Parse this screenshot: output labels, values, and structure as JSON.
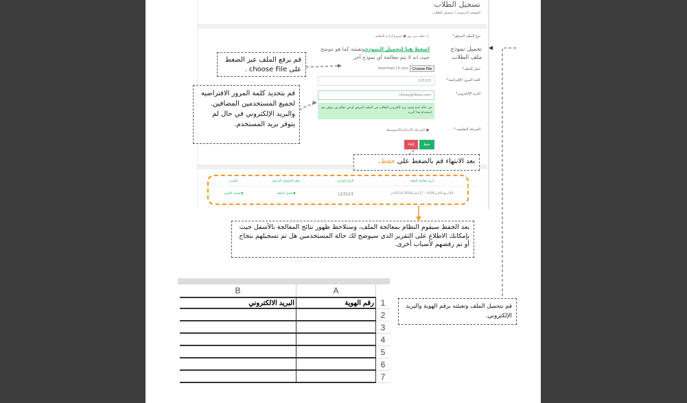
{
  "app": {
    "title": "تسجيل الطلاب",
    "breadcrumb_home": "الصفحة الرئيسية",
    "breadcrumb_sep": "/",
    "breadcrumb_current": "تسجيل الطلاب"
  },
  "form": {
    "file_type_label": "نوع الملف المرفق*",
    "radio_noor": "ملف من نور",
    "radio_template": "نموذج إدارة التعليم",
    "template_label": "تحميل نموذج ملف الطلاب",
    "template_link": "اضغط هنا لتحميل النموذج",
    "template_text": "وتعبئته كما هو موضح حيث انه لا يتم معالجة أي نموذج آخر",
    "upload_label": "حمل الملف*",
    "choose_file": "Choose File",
    "file_name": "download (3).xlsx",
    "password_label": "كلمة المرور الإفتراضية*",
    "password_value": "123123",
    "email_label": "البريد الإلكتروني*",
    "email_value": "t4edu@t4edu.com",
    "alert": "في حالة عدم وجود بريد الكتروني للطالب في الملف المرفق أو في نظام نور سوف يتم استخدام هذا البريد",
    "stage_label": "المرحلة التعليمية *",
    "stage_option": "المرحلة الابتدائية/المتوسطة",
    "save": "حفظ",
    "cancel": "إلغاء"
  },
  "table": {
    "headers": [
      "تاريخ معالجة الملف",
      "الرقم السري",
      "ملف التسجيل المرفق",
      "التقرير"
    ],
    "row": {
      "date": "30/ربيع الثاني/1439 - 17/يناير/2018 02:14 م",
      "password": "123123",
      "file": "تحميل الملف",
      "report": "تحميل التقرير"
    }
  },
  "callouts": {
    "upload": "قم برفع الملف عبر الضغط على choose File .",
    "password": "قم بتحديد كلمة المرور الافتراضية لجميع المستخدمين المضافين. والبريد الإلكتروني في حال لم يتوفر بريد المستخدم.",
    "save_prefix": "بعد الانتهاء قم بالضغط على ",
    "save_word": "حفظ",
    "save_suffix": ".",
    "result": "بعد الحفظ سيقوم النظام بمعالجة الملف، وستلاحظ ظهور نتائج المعالجة بالأسفل حيث بإمكانك الاطلاع على التقرير الذي سيوضح لك حالة المستخدمين هل تم تسجيلهم بنجاح أو تم رفضهم لأسباب أخرى.",
    "template": "قم  بتحميل الملف وتعبئته برقم الهوية والبريد الإلكتروني."
  },
  "sheet": {
    "columns": [
      "B",
      "A"
    ],
    "header_b": "البريد الالكتروني",
    "header_a": "رقم  الهوية",
    "rows": [
      "1",
      "2",
      "3",
      "4",
      "5",
      "6",
      "7"
    ]
  },
  "colors": {
    "green": "#1fb36b",
    "red": "#e2505f",
    "orange": "#f7941d",
    "alert_bg": "#c9f2cf"
  }
}
